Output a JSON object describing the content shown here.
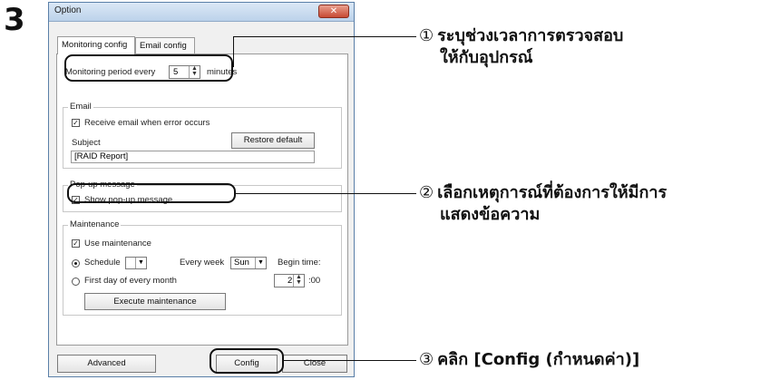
{
  "step_number": "3",
  "dialog": {
    "title": "Option",
    "close_glyph": "✕",
    "tabs": [
      "Monitoring config",
      "Email config"
    ],
    "monitoring": {
      "label": "Monitoring period every",
      "value": "5",
      "unit": "minutes"
    },
    "email": {
      "group_label": "Email",
      "receive_label": "Receive email when error occurs",
      "receive_checked": true,
      "subject_label": "Subject",
      "restore_button": "Restore default",
      "subject_value": "[RAID Report]"
    },
    "popup": {
      "group_label": "Pop-up message",
      "show_label": "Show pop-up message",
      "show_checked": true
    },
    "maintenance": {
      "group_label": "Maintenance",
      "use_label": "Use maintenance",
      "use_checked": true,
      "schedule_label": "Schedule",
      "schedule_value": "",
      "every_week_label": "Every week",
      "day_value": "Sun",
      "begin_time_label": "Begin time:",
      "first_day_label": "First day of every month",
      "hour_value": "2",
      "minute_suffix": ":00",
      "execute_button": "Execute maintenance"
    },
    "buttons": {
      "advanced": "Advanced",
      "config": "Config",
      "close": "Close"
    }
  },
  "callouts": [
    {
      "num": "①",
      "lines": [
        "ระบุช่วงเวลาการตรวจสอบ",
        "ให้กับอุปกรณ์"
      ]
    },
    {
      "num": "②",
      "lines": [
        "เลือกเหตุการณ์ที่ต้องการให้มีการ",
        "แสดงข้อความ"
      ]
    },
    {
      "num": "③",
      "lines": [
        "คลิก [Config (กำหนดค่า)]"
      ]
    }
  ]
}
